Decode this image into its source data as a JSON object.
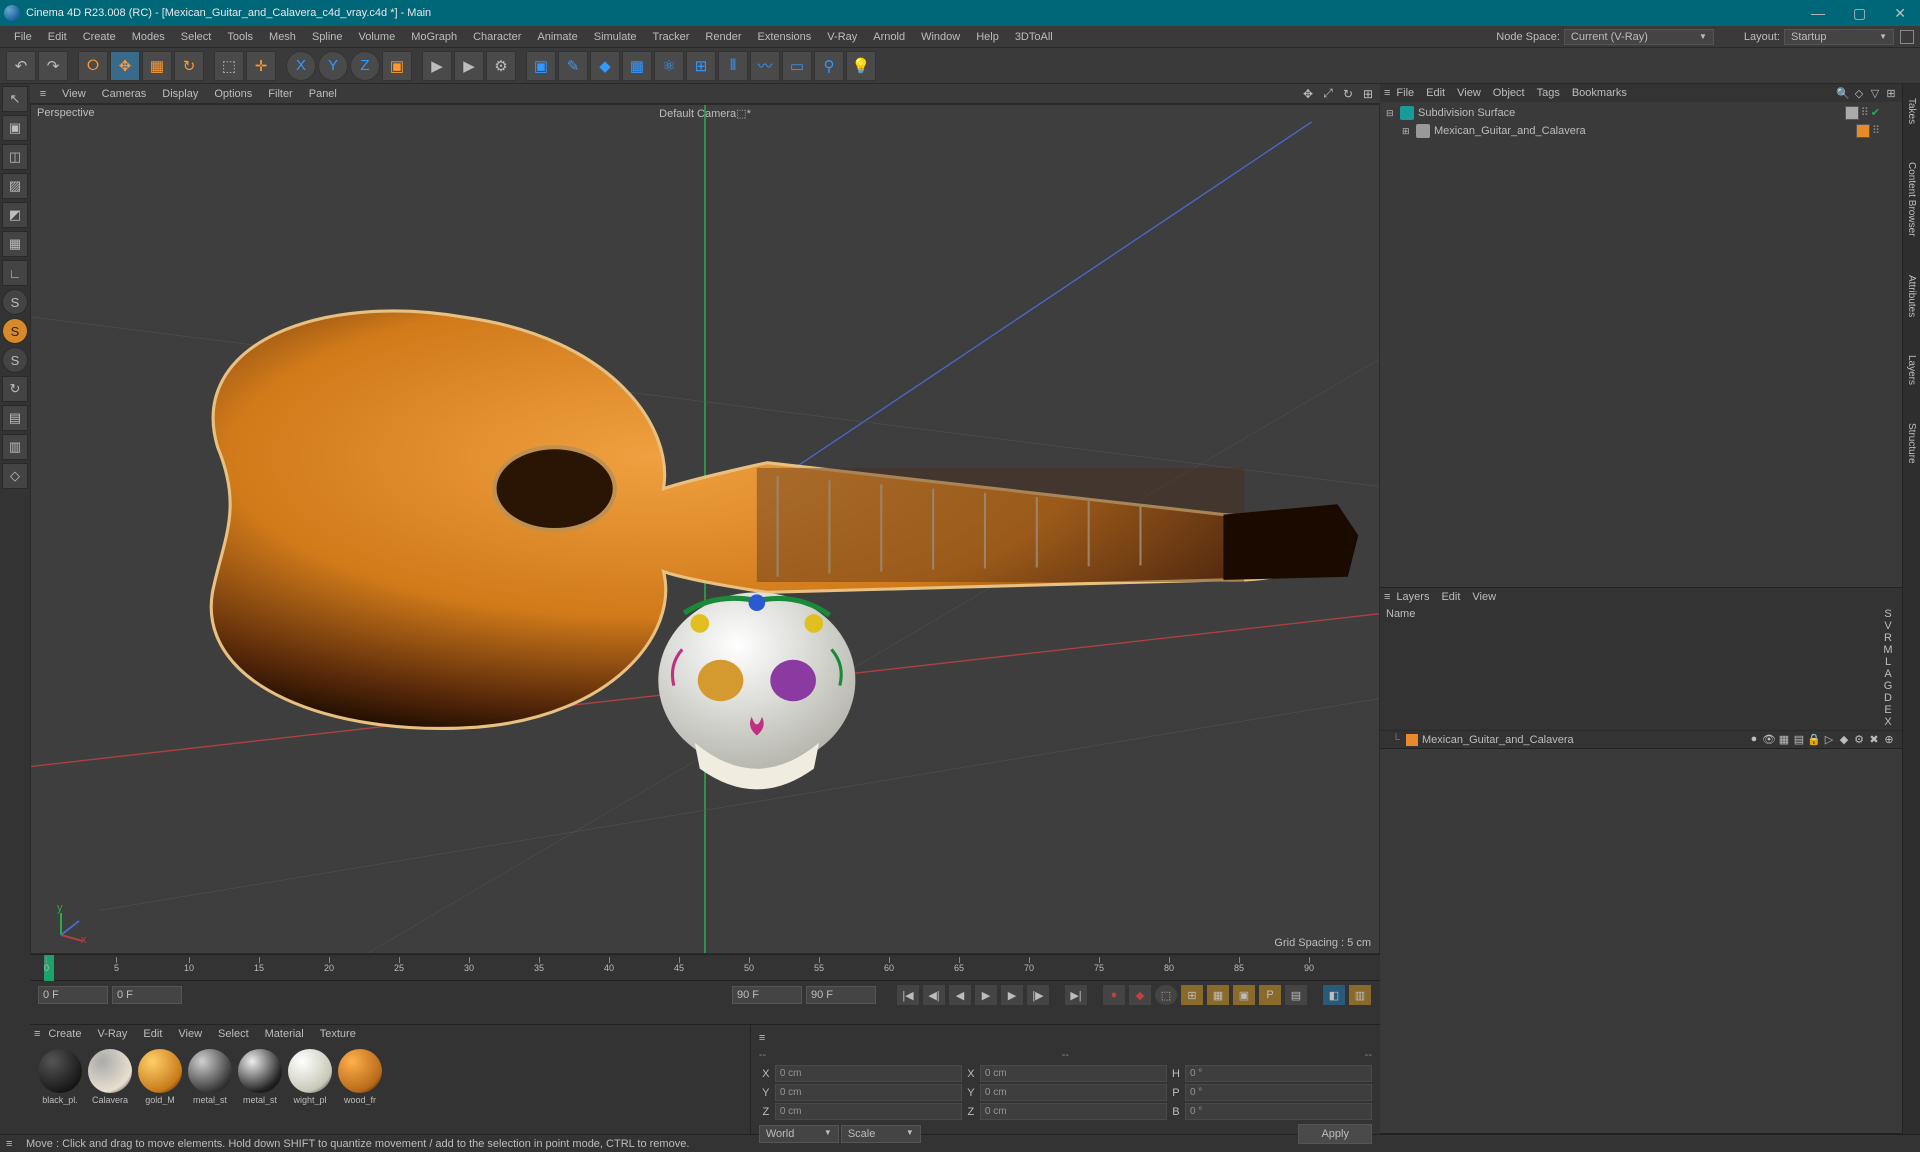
{
  "app": {
    "title": "Cinema 4D R23.008 (RC) - [Mexican_Guitar_and_Calavera_c4d_vray.c4d *] - Main"
  },
  "window_buttons": {
    "min": "—",
    "max": "▢",
    "close": "✕"
  },
  "menubar": {
    "items": [
      "File",
      "Edit",
      "Create",
      "Modes",
      "Select",
      "Tools",
      "Mesh",
      "Spline",
      "Volume",
      "MoGraph",
      "Character",
      "Animate",
      "Simulate",
      "Tracker",
      "Render",
      "Extensions",
      "V-Ray",
      "Arnold",
      "Window",
      "Help",
      "3DToAll"
    ],
    "nodespace_label": "Node Space:",
    "nodespace_value": "Current (V-Ray)",
    "layout_label": "Layout:",
    "layout_value": "Startup"
  },
  "toolbar": {
    "undo": "↶",
    "redo": "↷",
    "live": "⭘",
    "move": "✥",
    "scale": "▦",
    "rot": "↻",
    "lastTool": "⬚",
    "axis": "✛",
    "x": "X",
    "y": "Y",
    "z": "Z",
    "cube": "▣",
    "play": "▶",
    "rec": "●",
    "rend": "⚙",
    "blue1": "▣",
    "pen": "✎",
    "subd": "◆",
    "arr": "▦",
    "atom": "⚛",
    "clone": "⊞",
    "sym": "⦀",
    "bend": "〰",
    "floor": "▭",
    "cam": "⚲",
    "light": "💡"
  },
  "leftpal": {
    "items": [
      "↖",
      "▣",
      "◫",
      "▨",
      "◩",
      "▦",
      "∟",
      "S",
      "S",
      "S",
      "↻",
      "▤",
      "▥",
      "◇"
    ]
  },
  "viewport": {
    "menus": [
      "View",
      "Cameras",
      "Display",
      "Options",
      "Filter",
      "Panel"
    ],
    "persp": "Perspective",
    "camera": "Default Camera⬚*",
    "grid": "Grid Spacing : 5 cm"
  },
  "timeline": {
    "marks": [
      0,
      5,
      10,
      15,
      20,
      25,
      30,
      35,
      40,
      45,
      50,
      55,
      60,
      65,
      70,
      75,
      80,
      85,
      90
    ],
    "start": "0 F",
    "start2": "0 F",
    "end": "90 F",
    "end2": "90 F",
    "btns": {
      "first": "|◀",
      "prevk": "◀|",
      "prev": "◀",
      "play": "▶",
      "next": "▶",
      "nextk": "|▶",
      "last": "▶|",
      "rec": "●",
      "key": "◆",
      "auto": "⬚",
      "a1": "⊞",
      "a2": "▦",
      "a3": "▣",
      "a4": "P",
      "a5": "▤",
      "a6": "◧",
      "a7": "▥"
    }
  },
  "materials": {
    "menus": [
      "Create",
      "V-Ray",
      "Edit",
      "View",
      "Select",
      "Material",
      "Texture"
    ],
    "list": [
      {
        "name": "black_pl.",
        "c1": "#1a1a1a",
        "c2": "#555"
      },
      {
        "name": "Calavera",
        "c1": "#e8e0d0",
        "c2": "#aaa"
      },
      {
        "name": "gold_M",
        "c1": "#c87a1a",
        "c2": "#ffcf6a"
      },
      {
        "name": "metal_st",
        "c1": "#3a3a3a",
        "c2": "#d0d0d0"
      },
      {
        "name": "metal_st",
        "c1": "#222",
        "c2": "#eee"
      },
      {
        "name": "wight_pl",
        "c1": "#c8c8b8",
        "c2": "#fff"
      },
      {
        "name": "wood_fr",
        "c1": "#b86a1a",
        "c2": "#ffaf4a"
      }
    ]
  },
  "coords": {
    "dash": "--",
    "x_pos": "0 cm",
    "y_pos": "0 cm",
    "z_pos": "0 cm",
    "x_sz": "0 cm",
    "y_sz": "0 cm",
    "z_sz": "0 cm",
    "h": "0 °",
    "p": "0 °",
    "b": "0 °",
    "mode_l": "World",
    "mode_r": "Scale",
    "apply": "Apply",
    "labels": {
      "X": "X",
      "Y": "Y",
      "Z": "Z",
      "H": "H",
      "P": "P",
      "B": "B"
    }
  },
  "objmgr": {
    "menus": [
      "File",
      "Edit",
      "View",
      "Object",
      "Tags",
      "Bookmarks"
    ],
    "rows": [
      {
        "indent": 0,
        "exp": "⊟",
        "icon_bg": "#1a9a9a",
        "name": "Subdivision Surface",
        "tag1": "#aaa"
      },
      {
        "indent": 1,
        "exp": "⊞",
        "icon_bg": "#999",
        "name": "Mexican_Guitar_and_Calavera",
        "tag1": "#e88a2a"
      }
    ]
  },
  "layers": {
    "menus": [
      "Layers",
      "Edit",
      "View"
    ],
    "cols_name": "Name",
    "cols": [
      "S",
      "V",
      "R",
      "M",
      "L",
      "A",
      "G",
      "D",
      "E",
      "X"
    ],
    "row": {
      "name": "Mexican_Guitar_and_Calavera"
    }
  },
  "rtabs": [
    "Takes",
    "Content Browser",
    "Attributes",
    "Layers",
    "Structure"
  ],
  "status": {
    "text": "Move : Click and drag to move elements. Hold down SHIFT to quantize movement / add to the selection in point mode, CTRL to remove."
  }
}
